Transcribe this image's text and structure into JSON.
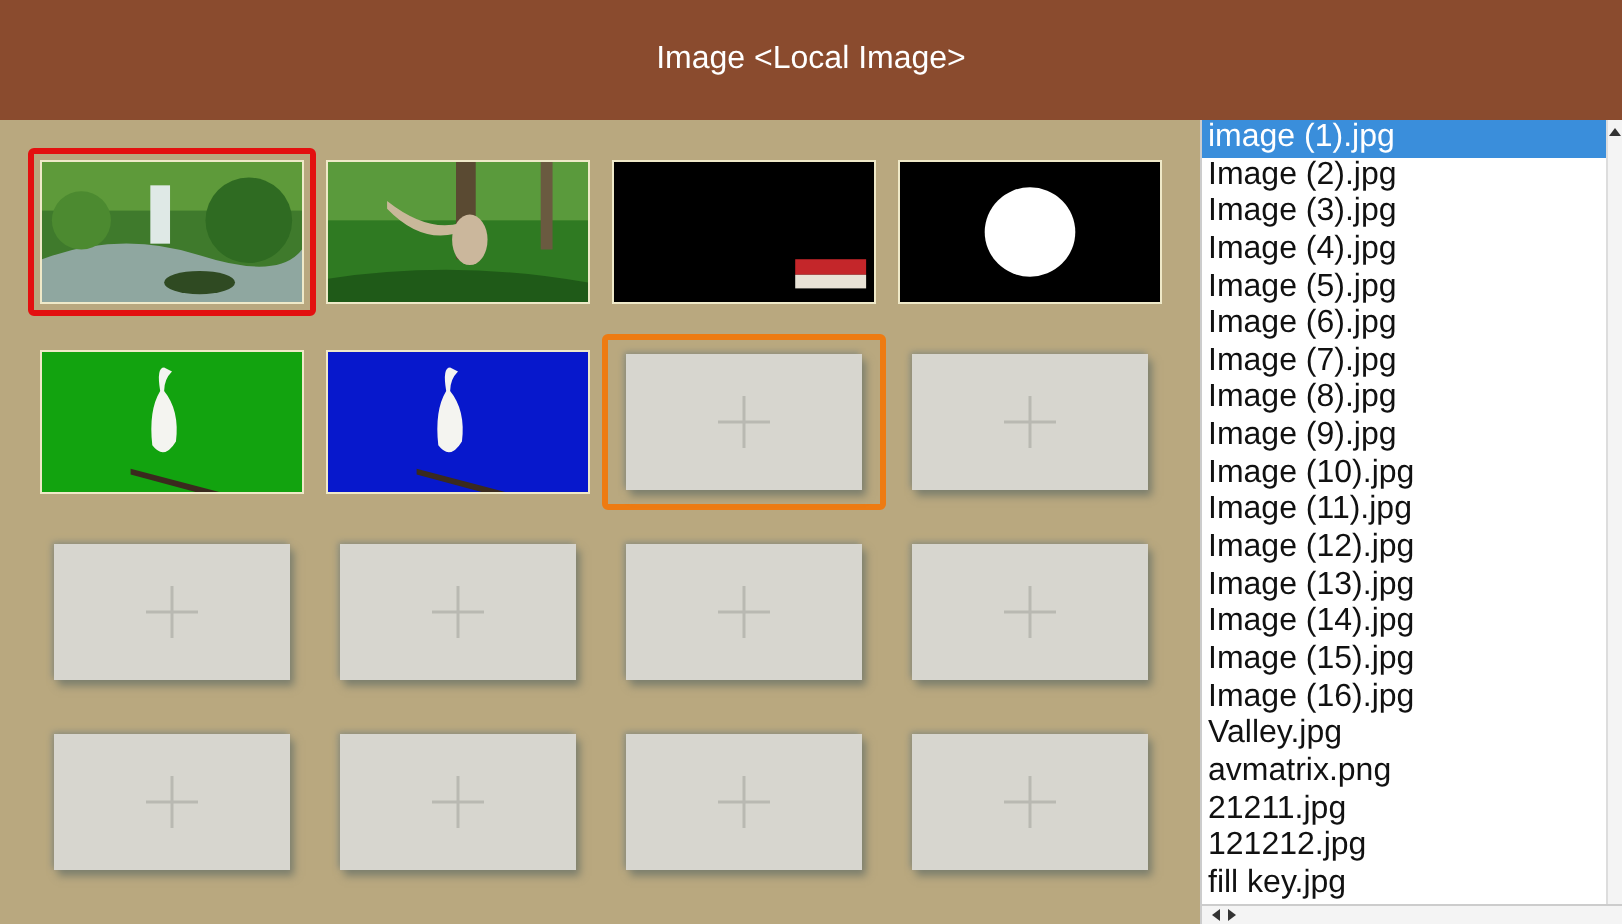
{
  "window": {
    "title": "Image <Local Image>"
  },
  "slots": [
    {
      "kind": "picture",
      "selected": true,
      "focused": false
    },
    {
      "kind": "picture",
      "selected": false,
      "focused": false
    },
    {
      "kind": "picture",
      "selected": false,
      "focused": false
    },
    {
      "kind": "picture",
      "selected": false,
      "focused": false
    },
    {
      "kind": "picture",
      "selected": false,
      "focused": false
    },
    {
      "kind": "picture",
      "selected": false,
      "focused": false
    },
    {
      "kind": "empty",
      "selected": false,
      "focused": true
    },
    {
      "kind": "empty",
      "selected": false,
      "focused": false
    },
    {
      "kind": "empty",
      "selected": false,
      "focused": false
    },
    {
      "kind": "empty",
      "selected": false,
      "focused": false
    },
    {
      "kind": "empty",
      "selected": false,
      "focused": false
    },
    {
      "kind": "empty",
      "selected": false,
      "focused": false
    },
    {
      "kind": "empty",
      "selected": false,
      "focused": false
    },
    {
      "kind": "empty",
      "selected": false,
      "focused": false
    },
    {
      "kind": "empty",
      "selected": false,
      "focused": false
    },
    {
      "kind": "empty",
      "selected": false,
      "focused": false
    }
  ],
  "files": [
    {
      "name": "image (1).jpg",
      "selected": true
    },
    {
      "name": "Image (2).jpg",
      "selected": false
    },
    {
      "name": "Image (3).jpg",
      "selected": false
    },
    {
      "name": "Image (4).jpg",
      "selected": false
    },
    {
      "name": "Image (5).jpg",
      "selected": false
    },
    {
      "name": "Image (6).jpg",
      "selected": false
    },
    {
      "name": "Image (7).jpg",
      "selected": false
    },
    {
      "name": "Image (8).jpg",
      "selected": false
    },
    {
      "name": "Image (9).jpg",
      "selected": false
    },
    {
      "name": "Image (10).jpg",
      "selected": false
    },
    {
      "name": "Image (11).jpg",
      "selected": false
    },
    {
      "name": "Image (12).jpg",
      "selected": false
    },
    {
      "name": "Image (13).jpg",
      "selected": false
    },
    {
      "name": "Image (14).jpg",
      "selected": false
    },
    {
      "name": "Image (15).jpg",
      "selected": false
    },
    {
      "name": "Image (16).jpg",
      "selected": false
    },
    {
      "name": "Valley.jpg",
      "selected": false
    },
    {
      "name": "avmatrix.png",
      "selected": false
    },
    {
      "name": "21211.jpg",
      "selected": false
    },
    {
      "name": "121212.jpg",
      "selected": false
    },
    {
      "name": "fill key.jpg",
      "selected": false
    }
  ]
}
